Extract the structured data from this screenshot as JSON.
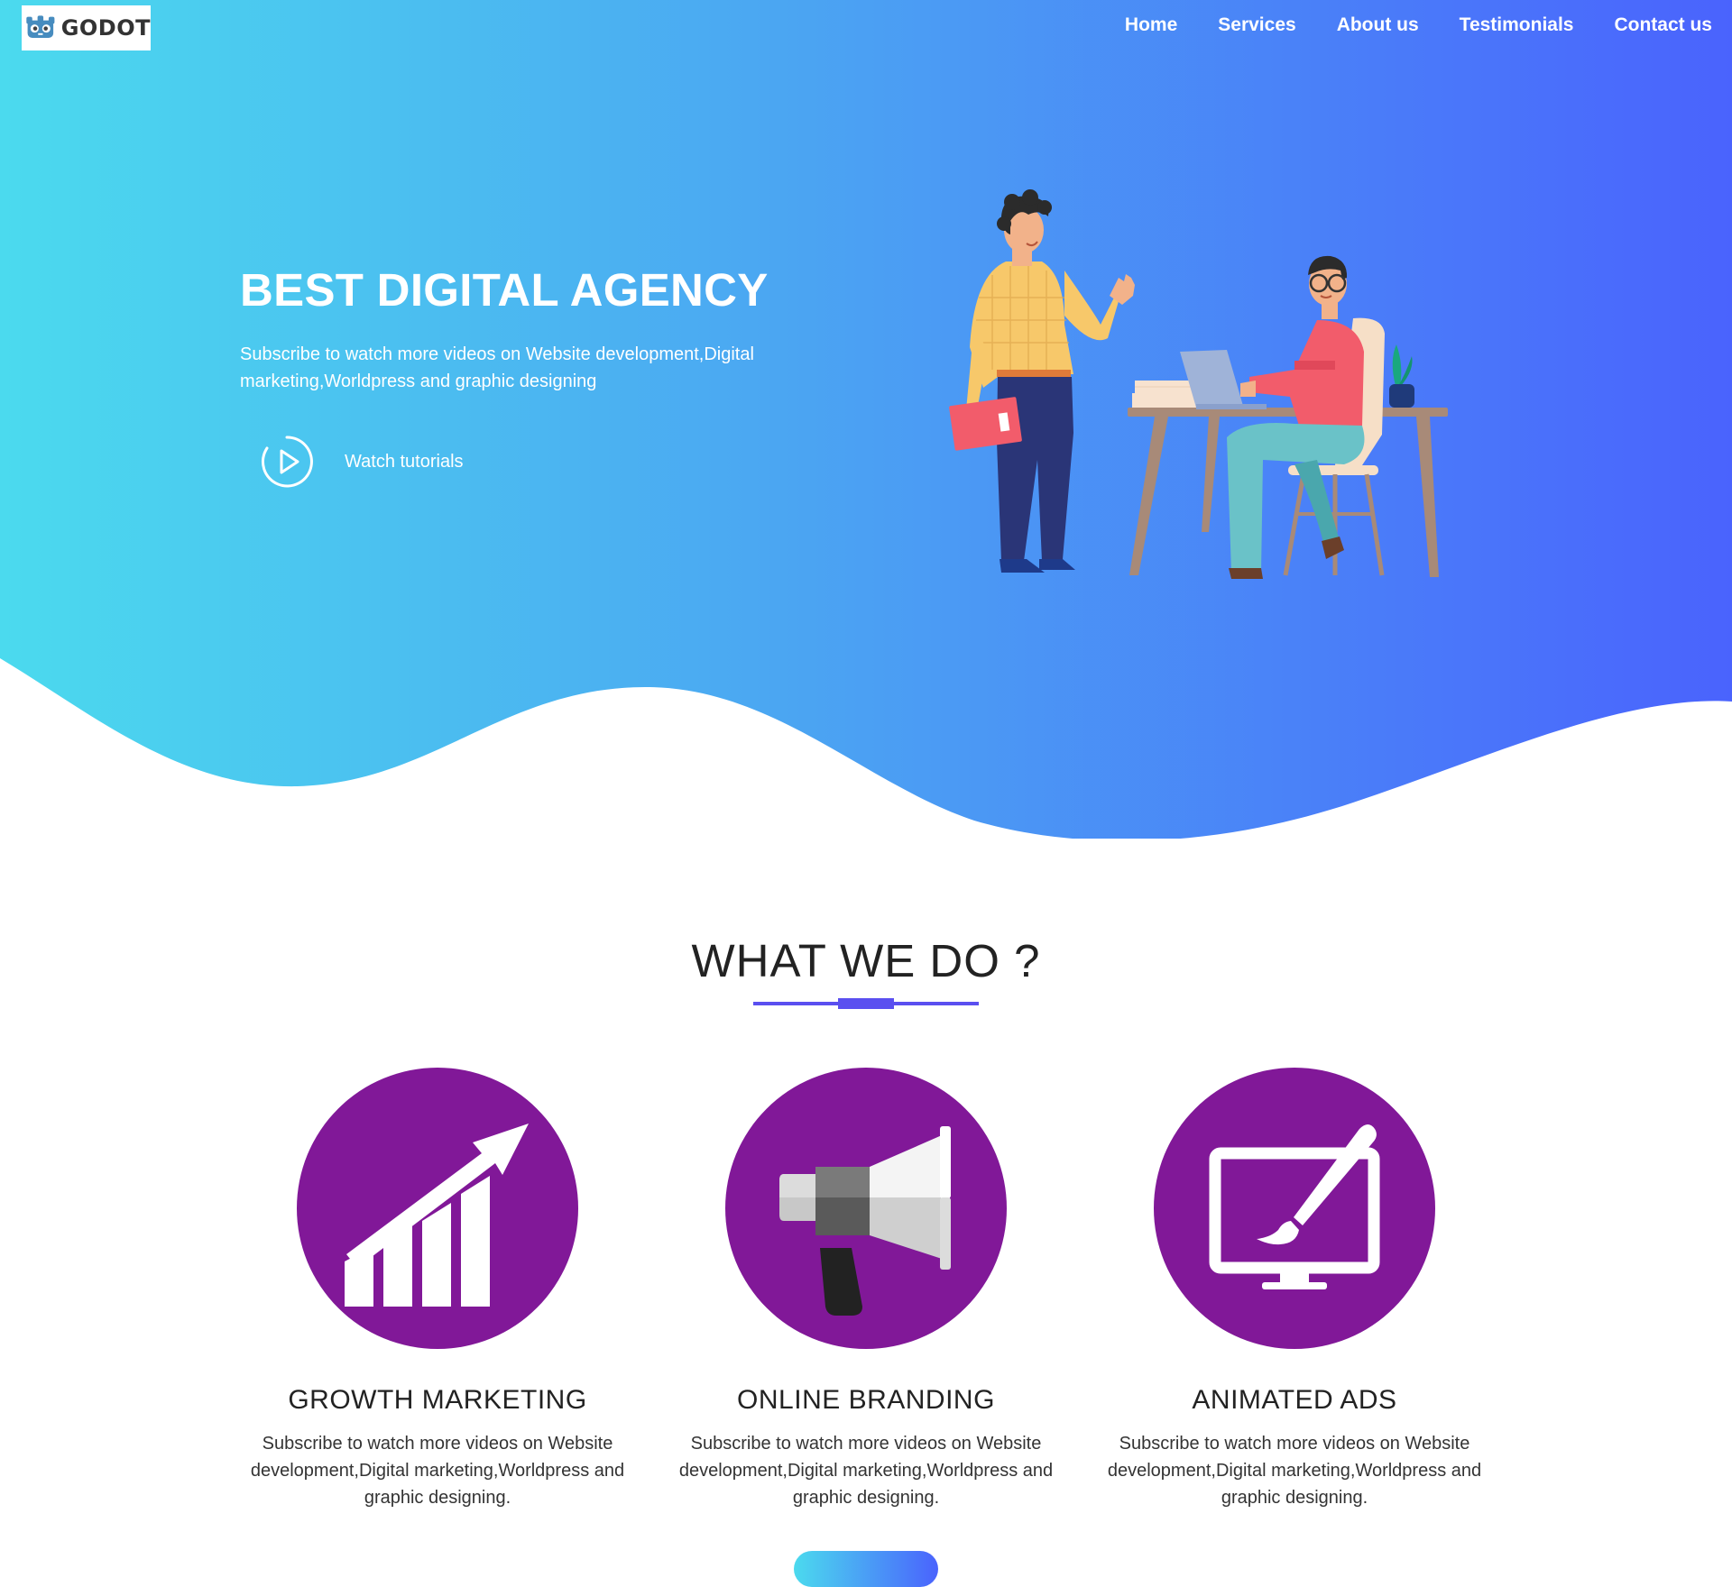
{
  "brand": {
    "logo_text": "GODOT",
    "logo_icon": "godot-robot-icon"
  },
  "nav": {
    "items": [
      {
        "label": "Home"
      },
      {
        "label": "Services"
      },
      {
        "label": "About us"
      },
      {
        "label": "Testimonials"
      },
      {
        "label": "Contact us"
      }
    ]
  },
  "hero": {
    "title": "BEST DIGITAL AGENCY",
    "subtitle": "Subscribe to watch more videos on Website development,Digital marketing,Worldpress and graphic designing",
    "cta_label": "Watch tutorials",
    "cta_icon": "play-circle-icon",
    "gradient_start": "#4bdaee",
    "gradient_end": "#4a63fd"
  },
  "what_we_do": {
    "title": "WHAT WE DO ?",
    "accent_color": "#5a4ff0",
    "services": [
      {
        "icon": "growth-chart-icon",
        "title": "GROWTH MARKETING",
        "description": "Subscribe to watch more videos on Website development,Digital marketing,Worldpress and graphic designing."
      },
      {
        "icon": "megaphone-icon",
        "title": "ONLINE BRANDING",
        "description": "Subscribe to watch more videos on Website development,Digital marketing,Worldpress and graphic designing."
      },
      {
        "icon": "monitor-brush-icon",
        "title": "ANIMATED ADS",
        "description": "Subscribe to watch more videos on Website development,Digital marketing,Worldpress and graphic designing."
      }
    ],
    "circle_color": "#811898"
  }
}
